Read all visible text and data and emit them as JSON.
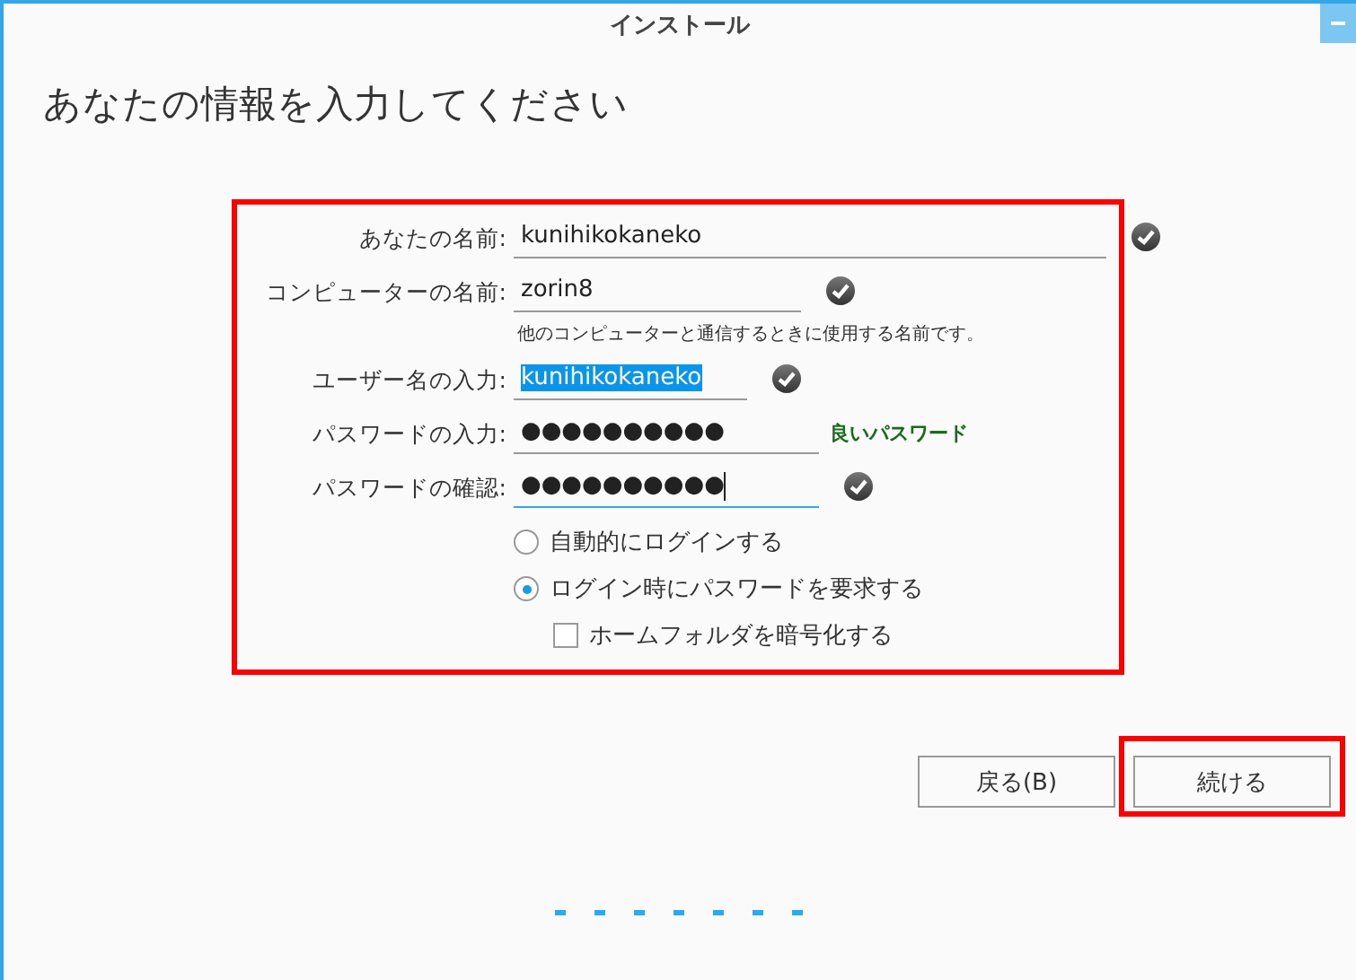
{
  "window": {
    "title": "インストール"
  },
  "heading": "あなたの情報を入力してください",
  "form": {
    "highlighted": true,
    "fields": [
      {
        "label": "あなたの名前:",
        "value": "kunihikokaneko",
        "kind": "check",
        "text_selected": false,
        "focused": false
      },
      {
        "label": "コンピューターの名前:",
        "value": "zorin8",
        "kind": "check",
        "text_selected": false,
        "focused": false,
        "hint": "他のコンピューターと通信するときに使用する名前です。"
      },
      {
        "label": "ユーザー名の入力:",
        "value": "kunihikokaneko",
        "kind": "check",
        "text_selected": true,
        "focused": false
      },
      {
        "label": "パスワードの入力:",
        "value": "●●●●●●●●●●",
        "kind": "strength",
        "strength": "良いパスワード",
        "text_selected": false,
        "focused": false
      },
      {
        "label": "パスワードの確認:",
        "value": "●●●●●●●●●●",
        "kind": "check",
        "text_selected": false,
        "focused": true
      }
    ],
    "options": [
      {
        "kind": "radio",
        "label": "自動的にログインする",
        "selected": false
      },
      {
        "kind": "radio",
        "label": "ログイン時にパスワードを要求する",
        "selected": true
      },
      {
        "kind": "checkbox",
        "label": "ホームフォルダを暗号化する",
        "checked": false
      }
    ]
  },
  "buttons": [
    {
      "label": "戻る(B)",
      "highlighted": false
    },
    {
      "label": "続ける",
      "highlighted": true
    }
  ]
}
